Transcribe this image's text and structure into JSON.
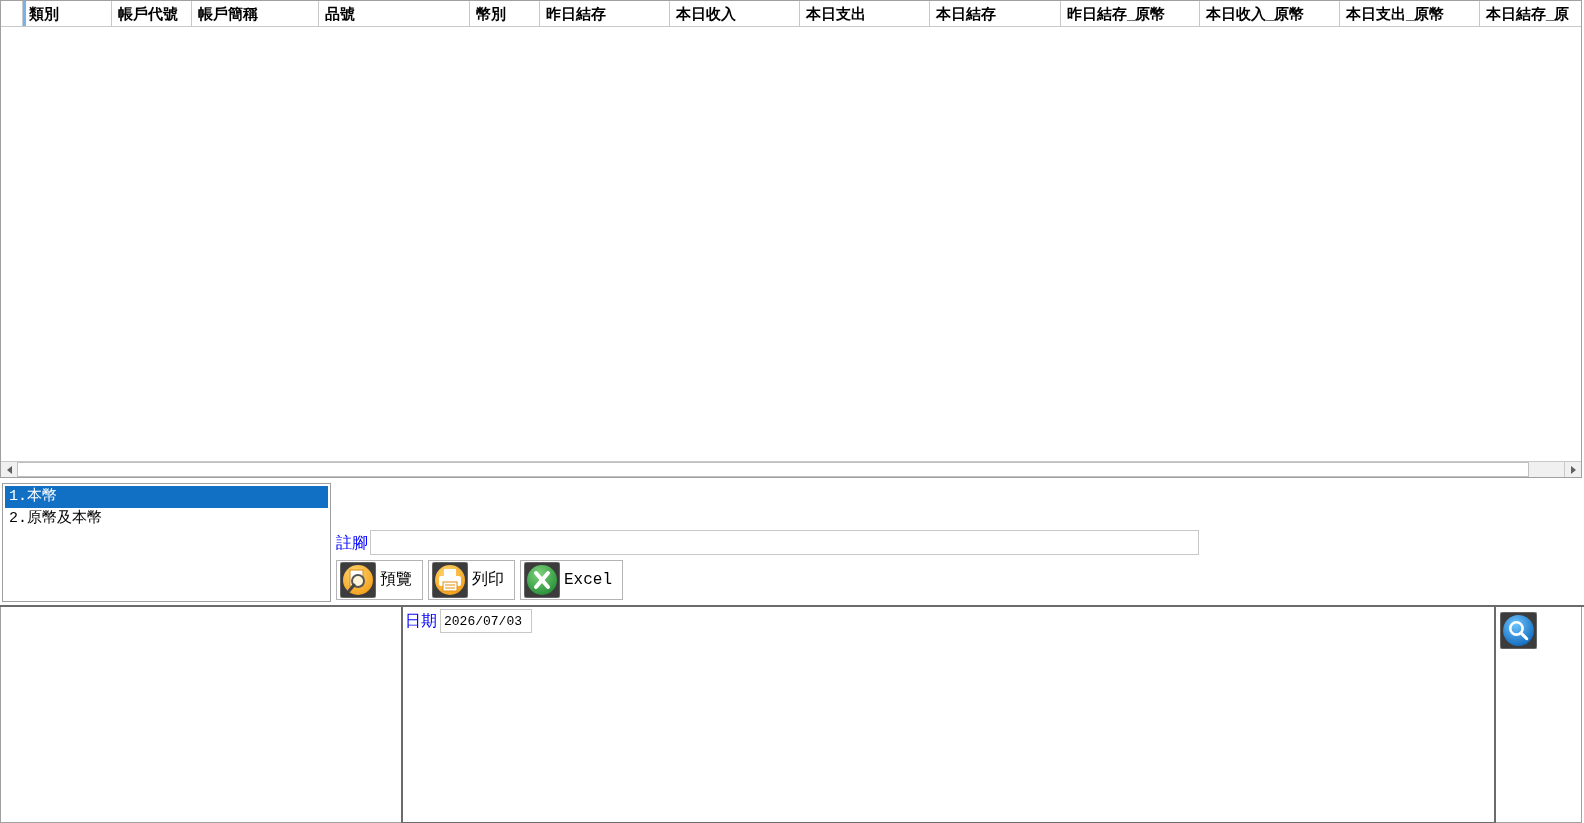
{
  "grid": {
    "columns": [
      {
        "label": "類別",
        "selected": true
      },
      {
        "label": "帳戶代號",
        "selected": false
      },
      {
        "label": "帳戶簡稱",
        "selected": false
      },
      {
        "label": "品號",
        "selected": false
      },
      {
        "label": "幣別",
        "selected": false
      },
      {
        "label": "昨日結存",
        "selected": false
      },
      {
        "label": "本日收入",
        "selected": false
      },
      {
        "label": "本日支出",
        "selected": false
      },
      {
        "label": "本日結存",
        "selected": false
      },
      {
        "label": "昨日結存_原幣",
        "selected": false
      },
      {
        "label": "本日收入_原幣",
        "selected": false
      },
      {
        "label": "本日支出_原幣",
        "selected": false
      },
      {
        "label": "本日結存_原",
        "selected": false
      }
    ]
  },
  "currency_mode": {
    "items": [
      {
        "label": "1.本幣",
        "selected": true
      },
      {
        "label": "2.原幣及本幣",
        "selected": false
      }
    ]
  },
  "footnote": {
    "label": "註腳"
  },
  "actions": [
    {
      "kind": "preview",
      "label": "預覽"
    },
    {
      "kind": "print",
      "label": "列印"
    },
    {
      "kind": "excel",
      "label": "Excel"
    }
  ],
  "date": {
    "label": "日期",
    "value": "2026/07/03"
  }
}
